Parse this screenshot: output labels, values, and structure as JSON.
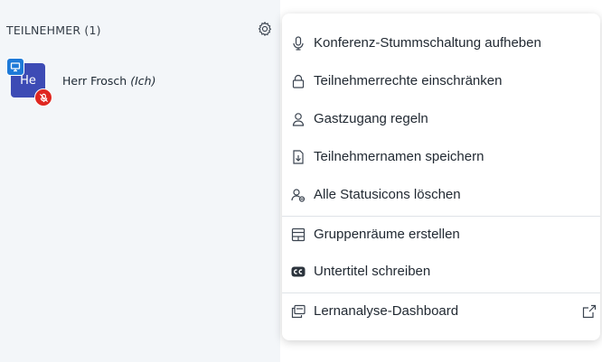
{
  "panel": {
    "title": "TEILNEHMER (1)",
    "settings_icon": "gear-icon"
  },
  "user": {
    "initials": "He",
    "name": "Herr Frosch",
    "suffix": "(Ich)",
    "avatar_color": "#3d4bb5",
    "presenter_icon": "presentation-icon",
    "muted_icon": "muted-microphone-icon"
  },
  "menu": {
    "items": [
      {
        "label": "Konferenz-Stummschaltung aufheben",
        "icon": "microphone-icon"
      },
      {
        "label": "Teilnehmerrechte einschränken",
        "icon": "lock-icon"
      },
      {
        "label": "Gastzugang regeln",
        "icon": "user-icon"
      },
      {
        "label": "Teilnehmernamen speichern",
        "icon": "download-file-icon"
      },
      {
        "label": "Alle Statusicons löschen",
        "icon": "clear-status-icon"
      },
      {
        "label": "Gruppenräume erstellen",
        "icon": "breakout-rooms-icon"
      },
      {
        "label": "Untertitel schreiben",
        "icon": "closed-captions-icon"
      },
      {
        "label": "Lernanalyse-Dashboard",
        "icon": "dashboard-icon",
        "trailing_icon": "external-link-icon"
      }
    ]
  },
  "colors": {
    "panel_bg": "#f3f6f9",
    "presenter_badge": "#1e7ad8",
    "muted_badge": "#df2721",
    "text": "#222a33"
  }
}
